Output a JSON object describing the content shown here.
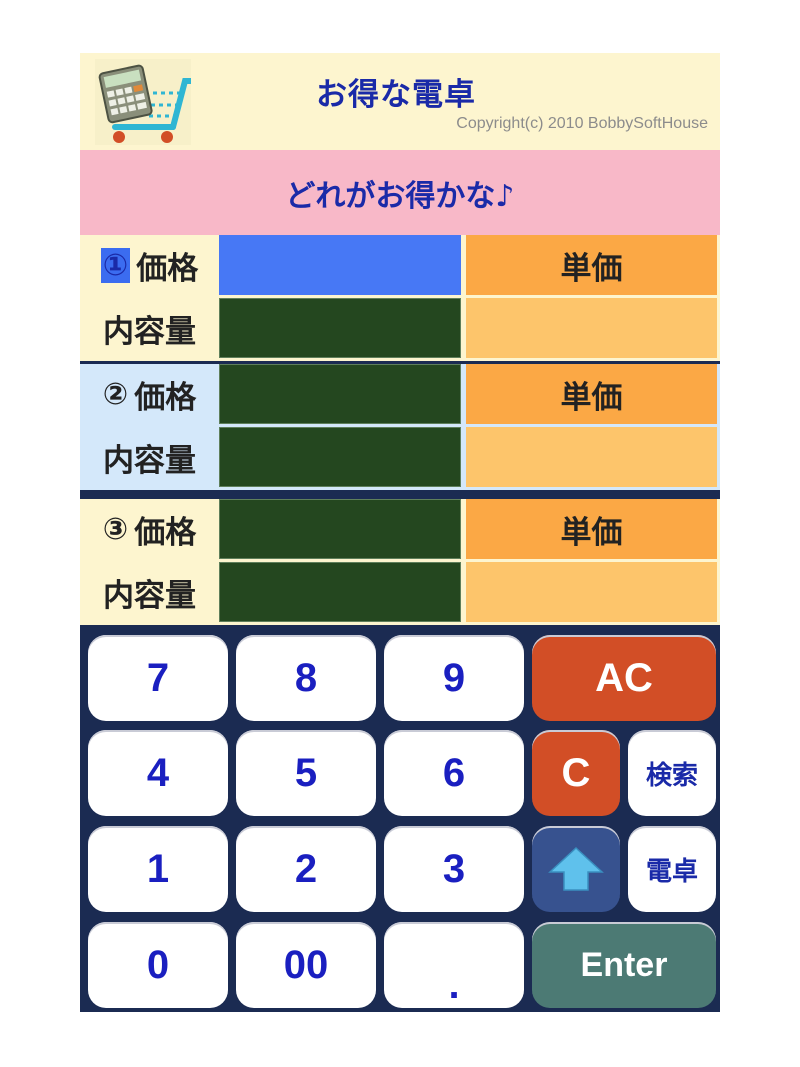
{
  "header": {
    "app_title": "お得な電卓",
    "copyright": "Copyright(c) 2010  BobbySoftHouse",
    "logo_icon": "calculator-cart-icon"
  },
  "banner": {
    "text": "どれがお得かな♪"
  },
  "items": [
    {
      "number": "①",
      "price_label": "価格",
      "quantity_label": "内容量",
      "unit_price_label": "単価",
      "selected": true
    },
    {
      "number": "②",
      "price_label": "価格",
      "quantity_label": "内容量",
      "unit_price_label": "単価",
      "selected": false
    },
    {
      "number": "③",
      "price_label": "価格",
      "quantity_label": "内容量",
      "unit_price_label": "単価",
      "selected": false
    }
  ],
  "keypad": {
    "k7": "7",
    "k8": "8",
    "k9": "9",
    "ac": "AC",
    "k4": "4",
    "k5": "5",
    "k6": "6",
    "c": "C",
    "search": "検索",
    "k1": "1",
    "k2": "2",
    "k3": "3",
    "up_icon": "up-arrow-icon",
    "calc": "電卓",
    "k0": "0",
    "k00": "00",
    "dot": ".",
    "enter": "Enter"
  },
  "colors": {
    "accent_blue": "#4778f5",
    "field_green": "#24471f",
    "unit_orange": "#fba845",
    "key_orange": "#d24e26",
    "key_teal": "#4c7a74",
    "keypad_bg": "#1b2b52"
  }
}
